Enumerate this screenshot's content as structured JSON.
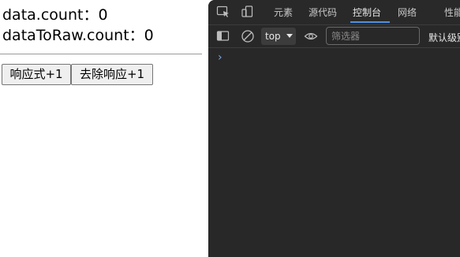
{
  "page": {
    "data_count_label": "data.count：0",
    "raw_count_label": "dataToRaw.count：0",
    "reactive_button": "响应式+1",
    "non_reactive_button": "去除响应+1"
  },
  "devtools": {
    "tabs": [
      {
        "label": "元素"
      },
      {
        "label": "源代码"
      },
      {
        "label": "控制台",
        "active": true
      },
      {
        "label": "网络"
      },
      {
        "label": "性能"
      }
    ],
    "toolbar": {
      "context": "top",
      "filter_placeholder": "筛选器",
      "levels_label": "默认级别"
    },
    "prompt": "›",
    "accent_color": "#4f8fe8"
  }
}
